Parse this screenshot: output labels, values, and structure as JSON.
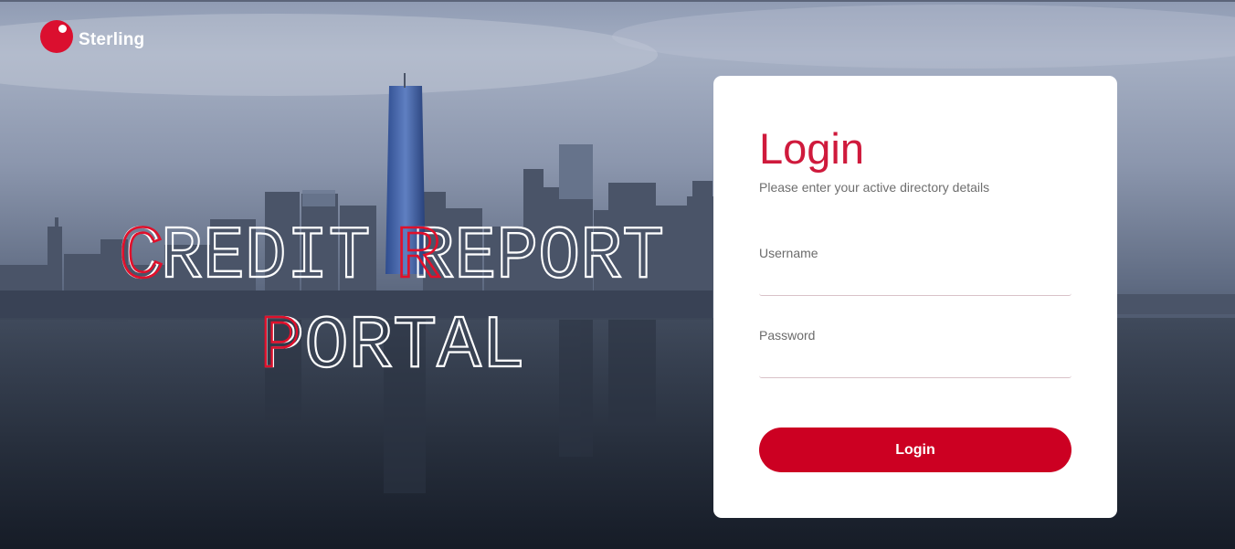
{
  "brand": {
    "name": "Sterling"
  },
  "hero": {
    "line1": "CREDIT REPORT",
    "line2": "PORTAL"
  },
  "login": {
    "heading": "Login",
    "subtitle": "Please enter your active directory details",
    "username_label": "Username",
    "username_value": "",
    "password_label": "Password",
    "password_value": "",
    "submit_label": "Login"
  },
  "colors": {
    "accent": "#cc0022",
    "heading": "#cf1a3c",
    "card_bg": "#ffffff"
  }
}
